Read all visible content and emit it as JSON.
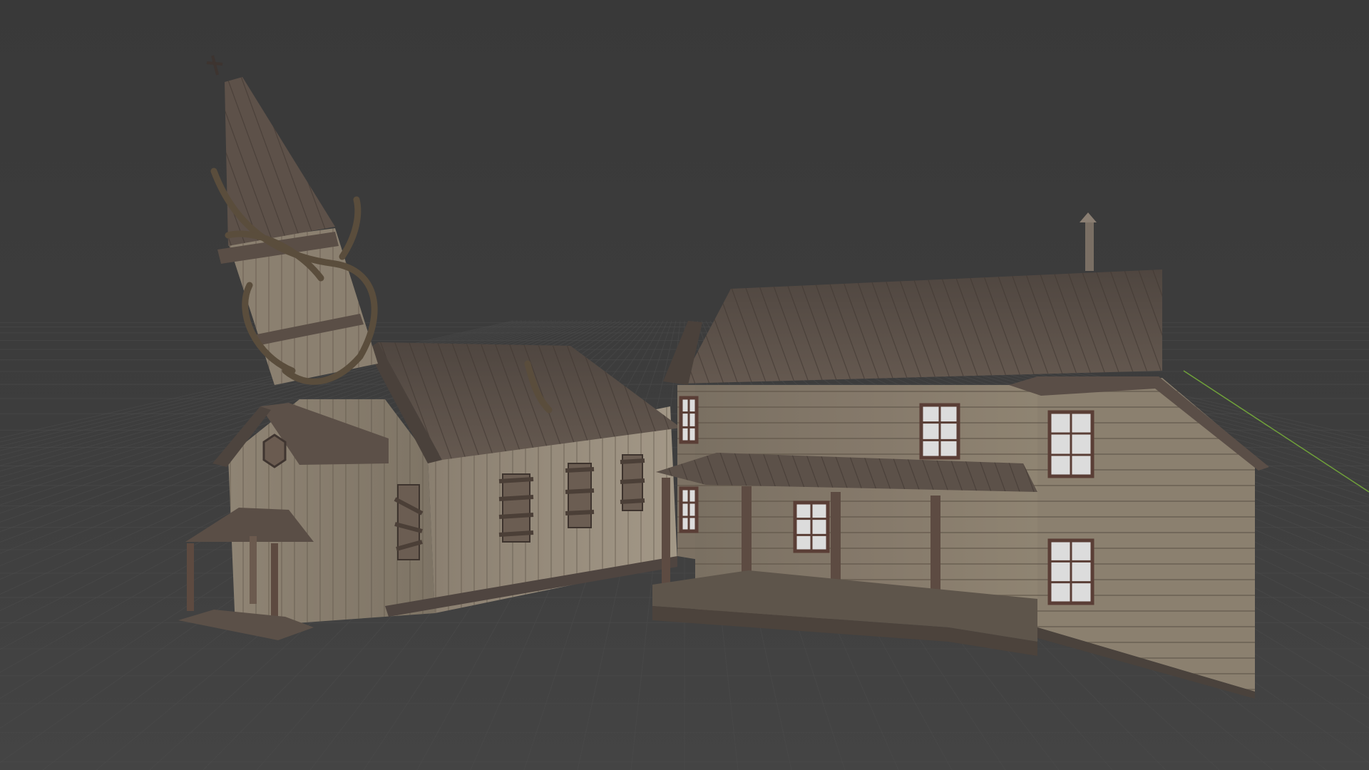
{
  "app": {
    "title": ""
  },
  "viewport": {
    "background_color": "#3c3c3c",
    "grid_color": "#4c4c4c",
    "x_axis_color": "#7a2a2a",
    "y_axis_color": "#6fa03a",
    "objects": [
      {
        "name": "abandoned-church",
        "kind": "3d-model"
      },
      {
        "name": "abandoned-two-story-house",
        "kind": "3d-model"
      }
    ]
  },
  "colors": {
    "roof": "#5b5049",
    "wood_light": "#8e8273",
    "wood_dark": "#6f6457",
    "trim": "#5a4a42",
    "window_glass": "#dcdcdc",
    "vine": "#5e5140"
  }
}
